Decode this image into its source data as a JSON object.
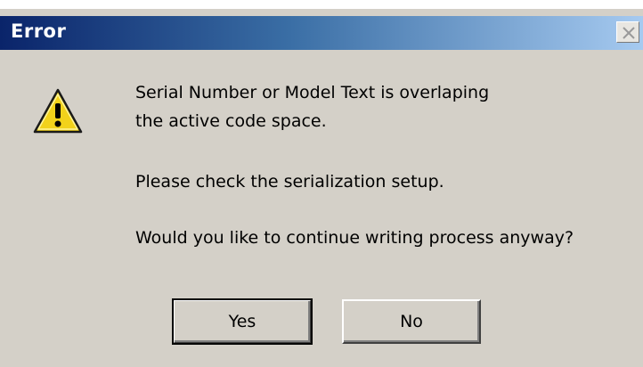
{
  "window": {
    "title": "Error",
    "close_icon": "close-icon"
  },
  "message": {
    "icon": "warning-icon",
    "line1": "Serial Number or Model Text is overlaping",
    "line2": "the active code space.",
    "line3": "Please check the serialization setup.",
    "line4": "Would you like to continue writing process anyway?"
  },
  "buttons": {
    "yes_label": "Yes",
    "no_label": "No"
  },
  "colors": {
    "title_gradient_start": "#0a246a",
    "title_gradient_end": "#a6caf0",
    "dialog_face": "#d4d0c8",
    "warning_yellow": "#f2d21b"
  }
}
